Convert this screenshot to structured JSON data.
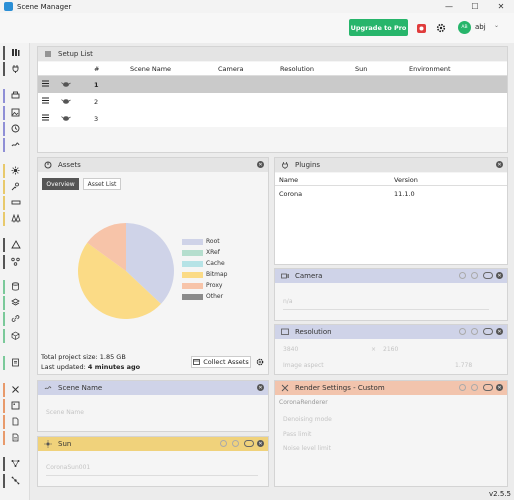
{
  "window": {
    "title": "Scene Manager",
    "minimize": "—",
    "maximize": "☐",
    "close": "✕"
  },
  "toolbar": {
    "upgrade_label": "Upgrade to Pro",
    "avatar_initials": "AB",
    "user_name": "abj",
    "user_chevron": "⌄"
  },
  "sidebar": {
    "items": [
      {
        "icon": "library-icon",
        "accent": "#555555"
      },
      {
        "icon": "plug-icon",
        "accent": "#555555"
      },
      {
        "icon": "printer-icon",
        "accent": "#8f8fd6"
      },
      {
        "icon": "image-icon",
        "accent": "#8f8fd6"
      },
      {
        "icon": "clock-icon",
        "accent": "#8f8fd6"
      },
      {
        "icon": "path-icon",
        "accent": "#8f8fd6"
      },
      {
        "icon": "sun-icon",
        "accent": "#e8c96b"
      },
      {
        "icon": "sun-person-icon",
        "accent": "#e8c96b"
      },
      {
        "icon": "rectangle-icon",
        "accent": "#e8c96b"
      },
      {
        "icon": "trees-icon",
        "accent": "#e8c96b"
      },
      {
        "icon": "triangle-icon",
        "accent": "#555555"
      },
      {
        "icon": "nodes-icon",
        "accent": "#555555"
      },
      {
        "icon": "stack-icon",
        "accent": "#7bc99a"
      },
      {
        "icon": "layers-icon",
        "accent": "#7bc99a"
      },
      {
        "icon": "link-icon",
        "accent": "#7bc99a"
      },
      {
        "icon": "cube-icon",
        "accent": "#7bc99a"
      },
      {
        "icon": "document-icon",
        "accent": "#7bc99a"
      },
      {
        "icon": "tools-icon",
        "accent": "#e89a6b"
      },
      {
        "icon": "picture-icon",
        "accent": "#e89a6b"
      },
      {
        "icon": "file-icon",
        "accent": "#e89a6b"
      },
      {
        "icon": "file-text-icon",
        "accent": "#e89a6b"
      },
      {
        "icon": "graph-icon",
        "accent": "#555555"
      },
      {
        "icon": "network-icon",
        "accent": "#555555"
      }
    ]
  },
  "setup_list": {
    "title": "Setup List",
    "columns": [
      "#",
      "Scene Name",
      "Camera",
      "Resolution",
      "Sun",
      "Environment"
    ],
    "rows": [
      {
        "num": "1",
        "selected": true
      },
      {
        "num": "2",
        "selected": false
      },
      {
        "num": "3",
        "selected": false
      }
    ]
  },
  "assets": {
    "title": "Assets",
    "tabs": [
      "Overview",
      "Asset List"
    ],
    "total_label": "Total project size:",
    "total_value": "1.85 GB",
    "updated_label": "Last updated:",
    "updated_value": "4 minutes ago",
    "collect_label": "Collect Assets",
    "legend": [
      {
        "label": "Root",
        "color": "#cfd3e8"
      },
      {
        "label": "XRef",
        "color": "#b5dece"
      },
      {
        "label": "Cache",
        "color": "#b6e3e6"
      },
      {
        "label": "Bitmap",
        "color": "#fbdb86"
      },
      {
        "label": "Proxy",
        "color": "#f7c4a9"
      },
      {
        "label": "Other",
        "color": "#8b8b8b"
      }
    ],
    "pie": [
      {
        "label": "Root",
        "fraction": 0.37
      },
      {
        "label": "Bitmap",
        "fraction": 0.48
      },
      {
        "label": "Proxy",
        "fraction": 0.15
      }
    ]
  },
  "plugins": {
    "title": "Plugins",
    "columns": [
      "Name",
      "Version"
    ],
    "rows": [
      {
        "name": "Corona",
        "version": "11.1.0"
      }
    ]
  },
  "camera": {
    "title": "Camera",
    "faded_value": "n/a"
  },
  "resolution": {
    "title": "Resolution",
    "width": "3840",
    "height": "2160",
    "aspect_label": "Image aspect",
    "aspect_value": "1.778"
  },
  "scene_name": {
    "title": "Scene Name",
    "faded_value": "Scene Name"
  },
  "sun": {
    "title": "Sun",
    "faded_value": "CoronaSun001"
  },
  "render_settings": {
    "title": "Render Settings - Custom",
    "renderer": "CoronaRenderer",
    "fields": [
      "Denoising mode",
      "Pass limit",
      "Noise level limit"
    ]
  },
  "version": "v2.5.5",
  "colors": {
    "accent_green": "#27b56b",
    "scene_name_header": "#cfd3e8",
    "camera_header": "#cfd3e8",
    "resolution_header": "#cfd3e8",
    "sun_header": "#f0d27b",
    "render_header": "#f2c4ad"
  }
}
